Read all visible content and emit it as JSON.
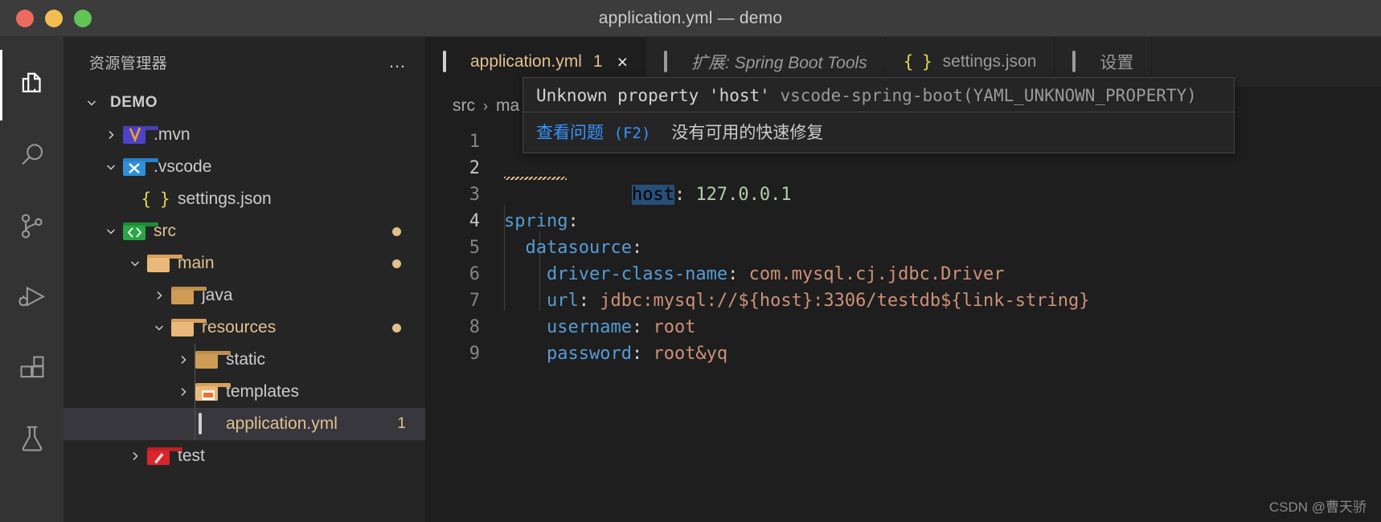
{
  "window": {
    "title": "application.yml — demo",
    "traffic_lights": [
      "close",
      "minimize",
      "zoom"
    ]
  },
  "activity_bar": {
    "items": [
      {
        "name": "explorer",
        "icon": "files-icon",
        "active": true
      },
      {
        "name": "search",
        "icon": "search-icon",
        "active": false
      },
      {
        "name": "source-control",
        "icon": "source-control-icon",
        "active": false
      },
      {
        "name": "run-and-debug",
        "icon": "run-debug-icon",
        "active": false
      },
      {
        "name": "extensions",
        "icon": "extensions-icon",
        "active": false
      },
      {
        "name": "testing",
        "icon": "beaker-icon",
        "active": false
      }
    ]
  },
  "sidebar": {
    "title": "资源管理器",
    "more_actions": "…",
    "root": {
      "label": "DEMO",
      "expanded": true
    },
    "tree": [
      {
        "label": ".mvn",
        "icon": "maven-folder-icon",
        "indent": 1,
        "twisty": "collapsed",
        "color": "gray",
        "badge": "",
        "dot": false,
        "selected": false
      },
      {
        "label": ".vscode",
        "icon": "vscode-folder-icon",
        "indent": 1,
        "twisty": "expanded",
        "color": "gray",
        "badge": "",
        "dot": false,
        "selected": false
      },
      {
        "label": "settings.json",
        "icon": "json-file-icon",
        "indent": 2,
        "twisty": "none",
        "color": "gray",
        "badge": "",
        "dot": false,
        "selected": false
      },
      {
        "label": "src",
        "icon": "src-folder-icon",
        "indent": 1,
        "twisty": "expanded",
        "color": "yellow",
        "badge": "",
        "dot": true,
        "selected": false
      },
      {
        "label": "main",
        "icon": "folder-icon",
        "indent": 2,
        "twisty": "expanded",
        "color": "yellow",
        "badge": "",
        "dot": true,
        "selected": false
      },
      {
        "label": "java",
        "icon": "folder-icon",
        "indent": 3,
        "twisty": "collapsed",
        "color": "gray",
        "badge": "",
        "dot": false,
        "selected": false
      },
      {
        "label": "resources",
        "icon": "folder-icon",
        "indent": 3,
        "twisty": "expanded",
        "color": "yellow",
        "badge": "",
        "dot": true,
        "selected": false
      },
      {
        "label": "static",
        "icon": "folder-icon",
        "indent": 4,
        "twisty": "collapsed",
        "color": "gray",
        "badge": "",
        "dot": false,
        "selected": false
      },
      {
        "label": "templates",
        "icon": "templates-folder-icon",
        "indent": 4,
        "twisty": "collapsed",
        "color": "gray",
        "badge": "",
        "dot": false,
        "selected": false
      },
      {
        "label": "application.yml",
        "icon": "file-icon",
        "indent": 4,
        "twisty": "none",
        "color": "yellow",
        "badge": "1",
        "dot": false,
        "selected": true
      },
      {
        "label": "test",
        "icon": "test-folder-icon",
        "indent": 2,
        "twisty": "collapsed",
        "color": "gray",
        "badge": "",
        "dot": false,
        "selected": false
      }
    ]
  },
  "editor": {
    "tabs": [
      {
        "label": "application.yml",
        "icon": "file-icon",
        "badge": "1",
        "active": true,
        "italic": false,
        "closable": true,
        "close": "×"
      },
      {
        "label": "扩展: Spring Boot Tools",
        "icon": "file-icon",
        "badge": "",
        "active": false,
        "italic": true,
        "closable": false,
        "close": ""
      },
      {
        "label": "settings.json",
        "icon": "json-file-icon",
        "badge": "",
        "active": false,
        "italic": false,
        "closable": false,
        "close": ""
      },
      {
        "label": "设置",
        "icon": "file-icon",
        "badge": "",
        "active": false,
        "italic": false,
        "closable": false,
        "close": ""
      }
    ],
    "breadcrumb": [
      "src",
      "ma"
    ],
    "breadcrumb_separator": "›",
    "line_numbers": [
      "1",
      "2",
      "3",
      "4",
      "5",
      "6",
      "7",
      "8",
      "9"
    ],
    "current_line": "2",
    "lines": [
      {
        "n": "1",
        "tokens": []
      },
      {
        "n": "2",
        "tokens": [
          {
            "t": "host",
            "c": "key-highlighted"
          },
          {
            "t": ":",
            "c": "punct"
          },
          {
            "t": " ",
            "c": "plain"
          },
          {
            "t": "127.0.0.1",
            "c": "number"
          }
        ]
      },
      {
        "n": "3",
        "tokens": []
      },
      {
        "n": "4",
        "tokens": [
          {
            "t": "spring",
            "c": "key"
          },
          {
            "t": ":",
            "c": "punct"
          }
        ]
      },
      {
        "n": "5",
        "tokens": [
          {
            "t": "  ",
            "c": "plain"
          },
          {
            "t": "datasource",
            "c": "key"
          },
          {
            "t": ":",
            "c": "punct"
          }
        ]
      },
      {
        "n": "6",
        "tokens": [
          {
            "t": "    ",
            "c": "plain"
          },
          {
            "t": "driver-class-name",
            "c": "key"
          },
          {
            "t": ":",
            "c": "punct"
          },
          {
            "t": " ",
            "c": "plain"
          },
          {
            "t": "com.mysql.cj.jdbc.Driver",
            "c": "string"
          }
        ]
      },
      {
        "n": "7",
        "tokens": [
          {
            "t": "    ",
            "c": "plain"
          },
          {
            "t": "url",
            "c": "key"
          },
          {
            "t": ":",
            "c": "punct"
          },
          {
            "t": " ",
            "c": "plain"
          },
          {
            "t": "jdbc:mysql://${host}:3306/testdb${link-string}",
            "c": "string"
          }
        ]
      },
      {
        "n": "8",
        "tokens": [
          {
            "t": "    ",
            "c": "plain"
          },
          {
            "t": "username",
            "c": "key"
          },
          {
            "t": ":",
            "c": "punct"
          },
          {
            "t": " ",
            "c": "plain"
          },
          {
            "t": "root",
            "c": "string"
          }
        ]
      },
      {
        "n": "9",
        "tokens": [
          {
            "t": "    ",
            "c": "plain"
          },
          {
            "t": "password",
            "c": "key"
          },
          {
            "t": ":",
            "c": "punct"
          },
          {
            "t": " ",
            "c": "plain"
          },
          {
            "t": "root&yq",
            "c": "string"
          }
        ]
      }
    ]
  },
  "hover": {
    "message": "Unknown property 'host'",
    "source": "vscode-spring-boot(YAML_UNKNOWN_PROPERTY)",
    "peek_link": "查看问题",
    "peek_shortcut": "(F2)",
    "no_quickfix": "没有可用的快速修复"
  },
  "watermark": "CSDN @曹天骄",
  "colors": {
    "accent_yellow": "#e2c08d",
    "key_blue": "#569cd6",
    "string_orange": "#ce9178",
    "number_green": "#b5cea8",
    "link_blue": "#3794ff",
    "selection_blue": "#264f78",
    "editor_bg": "#1e1e1e",
    "sidebar_bg": "#252526",
    "activitybar_bg": "#333333",
    "titlebar_bg": "#3c3c3c"
  }
}
